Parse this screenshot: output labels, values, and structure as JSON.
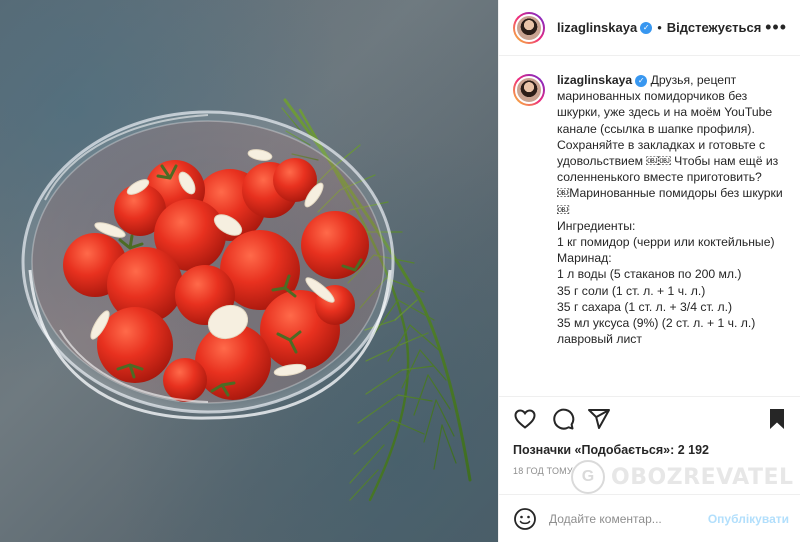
{
  "post": {
    "username": "lizaglinskaya",
    "follow_status": "Відстежується",
    "caption_username": "lizaglinskaya",
    "caption_lines": [
      "Друзья, рецепт маринованных помидорчиков без шкурки, уже здесь и на моём YouTube канале (ссылка в шапке профиля). Сохраняйте в закладках и готовьте с удовольствием ￼￼ Чтобы нам ещё из соленненького вместе приготовить?",
      "",
      "￼Маринованные помидоры без шкурки￼",
      "Ингредиенты:",
      "1 кг помидор (черри или коктейльные)",
      "",
      "Маринад:",
      "1 л воды (5 стаканов по 200 мл.)",
      "35 г соли (1 ст. л. + 1 ч. л.)",
      "35 г сахара (1 ст. л. + 3/4 ст. л.)",
      "35 мл уксуса (9%) (2 ст. л. + 1 ч. л.)",
      "лавровый лист"
    ],
    "likes_text": "Позначки «Подобається»: 2 192",
    "time_text": "18 год тому",
    "comment_placeholder": "Додайте коментар...",
    "post_button": "Опублікувати"
  },
  "icons": {
    "verified": "verified-badge-icon",
    "more": "more-options-icon",
    "like": "heart-icon",
    "comment": "comment-icon",
    "share": "paper-plane-icon",
    "save": "bookmark-icon",
    "emoji": "emoji-icon"
  },
  "watermark": {
    "letter": "G",
    "text": "OBOZREVATEL"
  },
  "colors": {
    "verified": "#3897f0",
    "post_disabled": "#b2dffc",
    "muted": "#8e8e8e"
  }
}
